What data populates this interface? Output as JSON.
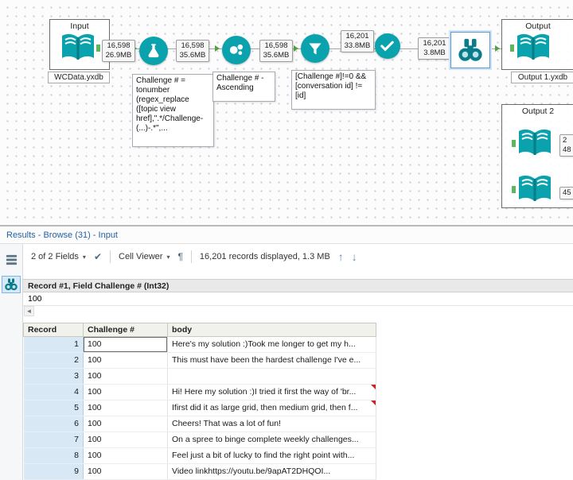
{
  "colors": {
    "tool_teal": "#0aa3ad",
    "title_blue": "#2461a8",
    "record_column_blue": "#d9e8f5",
    "selection_blue": "#5b9bd5",
    "truncate_red": "#cc2222",
    "anchor_green": "#5cb85c"
  },
  "icons": {
    "caret_down": "▾",
    "check": "✔",
    "pilcrow": "¶",
    "arrow_up": "↑",
    "arrow_down": "↓",
    "scroll_left": "◄"
  },
  "canvas": {
    "containers": {
      "input": {
        "label": "Input",
        "file_label": "WCData.yxdb"
      },
      "output": {
        "label": "Output",
        "file_label": "Output 1.yxdb"
      },
      "output2": {
        "label": "Output 2"
      }
    },
    "badges": [
      {
        "count": "16,598",
        "size": "26.9MB"
      },
      {
        "count": "16,598",
        "size": "35.6MB"
      },
      {
        "count": "16,598",
        "size": "35.6MB"
      },
      {
        "count": "16,201",
        "size": "33.8MB"
      },
      {
        "count": "16,201",
        "size": "3.8MB"
      },
      {
        "count": "2",
        "size": "48"
      },
      {
        "count": "45",
        "size": ""
      }
    ],
    "annotations": {
      "formula": "Challenge # = tonumber (regex_replace ([topic view href],\".*/Challenge-(...)-.*\",...",
      "sort": "Challenge # - Ascending",
      "filter": "[Challenge #]!=0 && [conversation id] != [id]"
    }
  },
  "results": {
    "title": "Results - Browse (31) - Input",
    "toolbar": {
      "fields_dropdown": "2 of 2 Fields",
      "cell_viewer_dropdown": "Cell Viewer",
      "records_info": "16,201 records displayed, 1.3 MB"
    },
    "cell_viewer": {
      "header": "Record #1, Field Challenge # (Int32)",
      "value": "100"
    },
    "table": {
      "columns": [
        "Record",
        "Challenge #",
        "body"
      ],
      "rows": [
        {
          "record": "1",
          "challenge": "100",
          "body": "Here's my solution :)Took me longer to get my h...",
          "truncated": false,
          "active": true
        },
        {
          "record": "2",
          "challenge": "100",
          "body": "This must have been the hardest challenge I've e...",
          "truncated": false
        },
        {
          "record": "3",
          "challenge": "100",
          "body": "",
          "truncated": false
        },
        {
          "record": "4",
          "challenge": "100",
          "body": "Hi! Here my solution :)I tried it first the way of 'br...",
          "truncated": true
        },
        {
          "record": "5",
          "challenge": "100",
          "body": "Ifirst did it as large grid, then medium grid, then f...",
          "truncated": true
        },
        {
          "record": "6",
          "challenge": "100",
          "body": "Cheers! That was a lot of fun!",
          "truncated": false
        },
        {
          "record": "7",
          "challenge": "100",
          "body": "On a spree to binge complete weekly challenges...",
          "truncated": false
        },
        {
          "record": "8",
          "challenge": "100",
          "body": "Feel just a bit of lucky to find the right point with...",
          "truncated": false
        },
        {
          "record": "9",
          "challenge": "100",
          "body": "Video linkhttps://youtu.be/9apAT2DHQOI...",
          "truncated": false
        }
      ]
    }
  }
}
